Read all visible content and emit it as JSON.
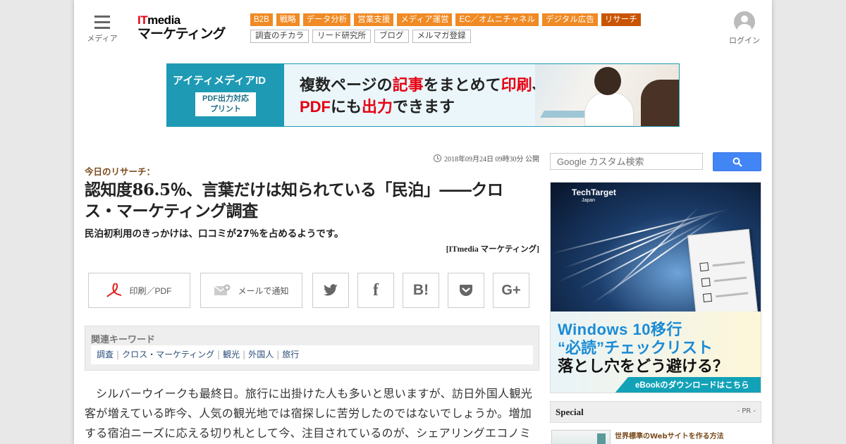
{
  "header": {
    "menu_label": "メディア",
    "logo_line1_red": "IT",
    "logo_line1_rest": "media",
    "logo_line2": "マーケティング",
    "login_label": "ログイン",
    "nav_primary": [
      "B2B",
      "戦略",
      "データ分析",
      "営業支援",
      "メディア運営",
      "EC／オムニチャネル",
      "デジタル広告",
      "リサーチ"
    ],
    "nav_primary_active": "リサーチ",
    "nav_secondary": [
      "調査のチカラ",
      "リード研究所",
      "ブログ",
      "メルマガ登録"
    ]
  },
  "banner": {
    "brand": "アイティメディアID",
    "box_line1": "PDF出力対応",
    "box_line2": "プリント",
    "msg_line1_a": "複数ページの",
    "msg_line1_b": "記事",
    "msg_line1_c": "をまとめて",
    "msg_line1_d": "印刷",
    "msg_line1_e": "、",
    "msg_line2_a": "PDF",
    "msg_line2_b": "にも",
    "msg_line2_c": "出力",
    "msg_line2_d": "できます"
  },
  "article": {
    "date": "2018年09月24日 09時30分 公開",
    "kicker": "今日のリサーチ：",
    "title": "認知度86.5％、言葉だけは知られている「民泊」――クロス・マーケティング調査",
    "subtitle": "民泊初利用のきっかけは、口コミが27％を占めるようです。",
    "credit": "[ITmedia マーケティング]",
    "share": {
      "print_label": "印刷／PDF",
      "mail_label": "メールで通知"
    },
    "keywords_heading": "関連キーワード",
    "keywords": [
      "調査",
      "クロス・マーケティング",
      "観光",
      "外国人",
      "旅行"
    ],
    "body": "シルバーウイークも最終日。旅行に出掛けた人も多いと思いますが、訪日外国人観光客が増えている昨今、人気の観光地では宿探しに苦労したのではないでしょうか。増加する宿泊ニーズに応える切り札として今、注目されているのが、シェアリングエコノミーの代表格である「民泊」です。"
  },
  "sidebar": {
    "search_placeholder": "Google カスタム検索",
    "ad": {
      "brand": "TechTarget",
      "brand_sub": "Japan",
      "line1": "Windows 10移行",
      "line2": "“必読”チェックリスト",
      "line3": "落とし穴をどう避ける？",
      "cta": "eBookのダウンロードはこちら"
    },
    "special_heading": "Special",
    "special_pr": "- PR -",
    "special_item": "世界標準のWebサイトを作る方法"
  }
}
